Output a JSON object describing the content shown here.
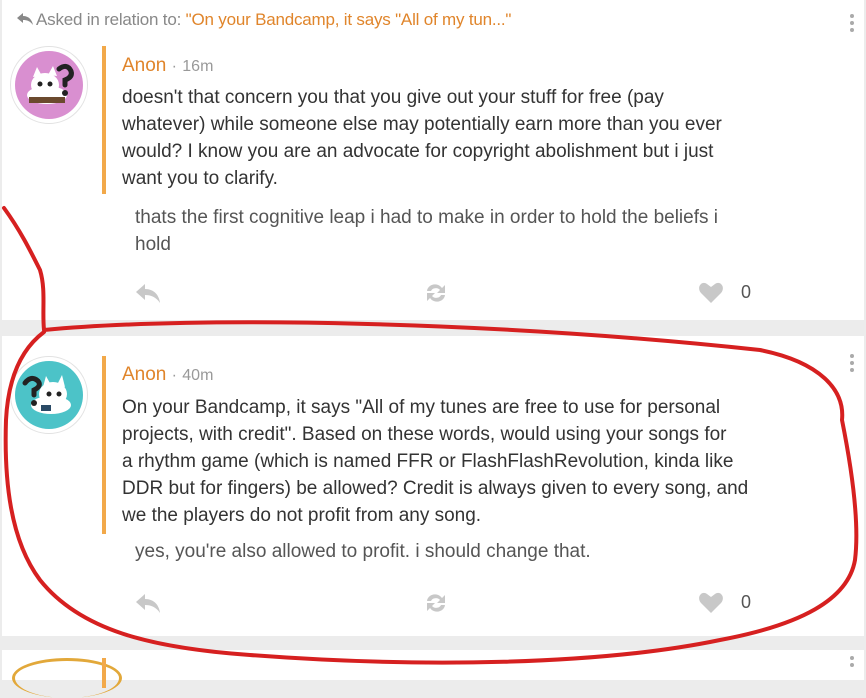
{
  "context": {
    "label": "Asked in relation to:",
    "quote": "\"On your Bandcamp, it says \"All of my tun...\""
  },
  "posts": [
    {
      "author": "Anon",
      "separator": "·",
      "time": "16m",
      "question_lines": [
        "doesn't that concern you that you give out your stuff for free (pay",
        "whatever) while someone else may potentially earn more than you ever",
        "would? I know you are an advocate for copyright abolishment but i just",
        "want you to clarify."
      ],
      "answer_lines": [
        "thats the first cognitive leap i had to make in order to hold the beliefs i",
        "hold"
      ],
      "like_count": "0",
      "avatar_color": "#d98fd0"
    },
    {
      "author": "Anon",
      "separator": "·",
      "time": "40m",
      "question_lines": [
        "On your Bandcamp, it says \"All of my tunes are free to use for personal",
        "projects, with credit\". Based on these words, would using your songs for",
        "a rhythm game (which is named FFR or FlashFlashRevolution, kinda like",
        "DDR but for fingers) be allowed? Credit is always given to every song, and",
        "we the players do not profit from any song."
      ],
      "answer_lines": [
        "yes, you're also allowed to profit. i should change that."
      ],
      "like_count": "0",
      "avatar_color": "#4cc3c8"
    }
  ],
  "icons": {
    "reply": "reply-arrow-icon",
    "share": "reshare-icon",
    "like": "heart-icon",
    "menu": "kebab-menu-icon"
  },
  "colors": {
    "accent": "#e0852b",
    "quote_bar": "#f2a94a",
    "annotation_circle": "#d62020"
  }
}
